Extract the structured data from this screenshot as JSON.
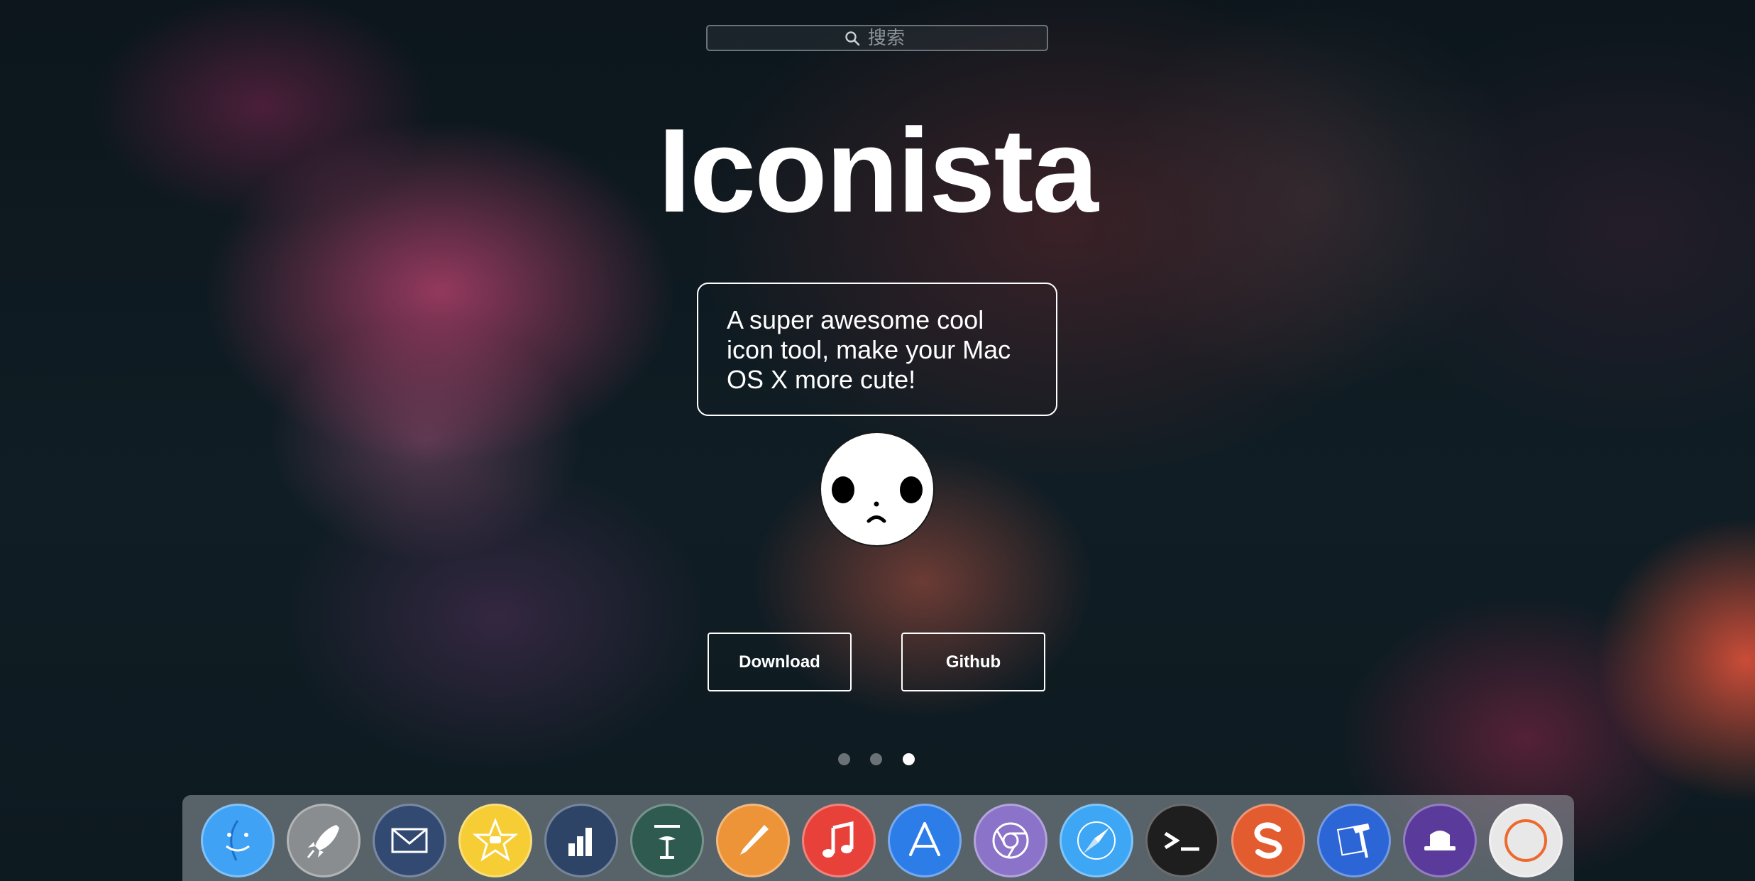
{
  "search": {
    "placeholder": "搜索",
    "icon": "search-icon"
  },
  "hero": {
    "title": "Iconista",
    "tagline": "A super awesome cool icon tool, make your Mac OS X more cute!",
    "mascot": "mascot-face-icon"
  },
  "buttons": {
    "download": "Download",
    "github": "Github"
  },
  "pagination": {
    "total": 3,
    "current": 3
  },
  "dock": {
    "items": [
      {
        "icon": "finder-icon",
        "color": "#3fa2f4"
      },
      {
        "icon": "launchpad-rocket-icon",
        "color": "#8a8d90"
      },
      {
        "icon": "mail-icon",
        "color": "#324a72"
      },
      {
        "icon": "imovie-star-icon",
        "color": "#f6cd34"
      },
      {
        "icon": "numbers-chart-icon",
        "color": "#2d4466"
      },
      {
        "icon": "keynote-podium-icon",
        "color": "#2f5a50"
      },
      {
        "icon": "pages-pen-icon",
        "color": "#ee9438"
      },
      {
        "icon": "music-note-icon",
        "color": "#e8413a"
      },
      {
        "icon": "app-store-icon",
        "color": "#2d7de8"
      },
      {
        "icon": "chrome-icon",
        "color": "#8a73c8"
      },
      {
        "icon": "safari-compass-icon",
        "color": "#3da6f5"
      },
      {
        "icon": "terminal-icon",
        "color": "#1e1e1e"
      },
      {
        "icon": "sublime-s-icon",
        "color": "#e25c30"
      },
      {
        "icon": "xcode-hammer-icon",
        "color": "#2c65d6"
      },
      {
        "icon": "alfred-hat-icon",
        "color": "#5a3a9a"
      },
      {
        "icon": "generic-app-icon",
        "color": "#e8e8e8"
      }
    ]
  }
}
